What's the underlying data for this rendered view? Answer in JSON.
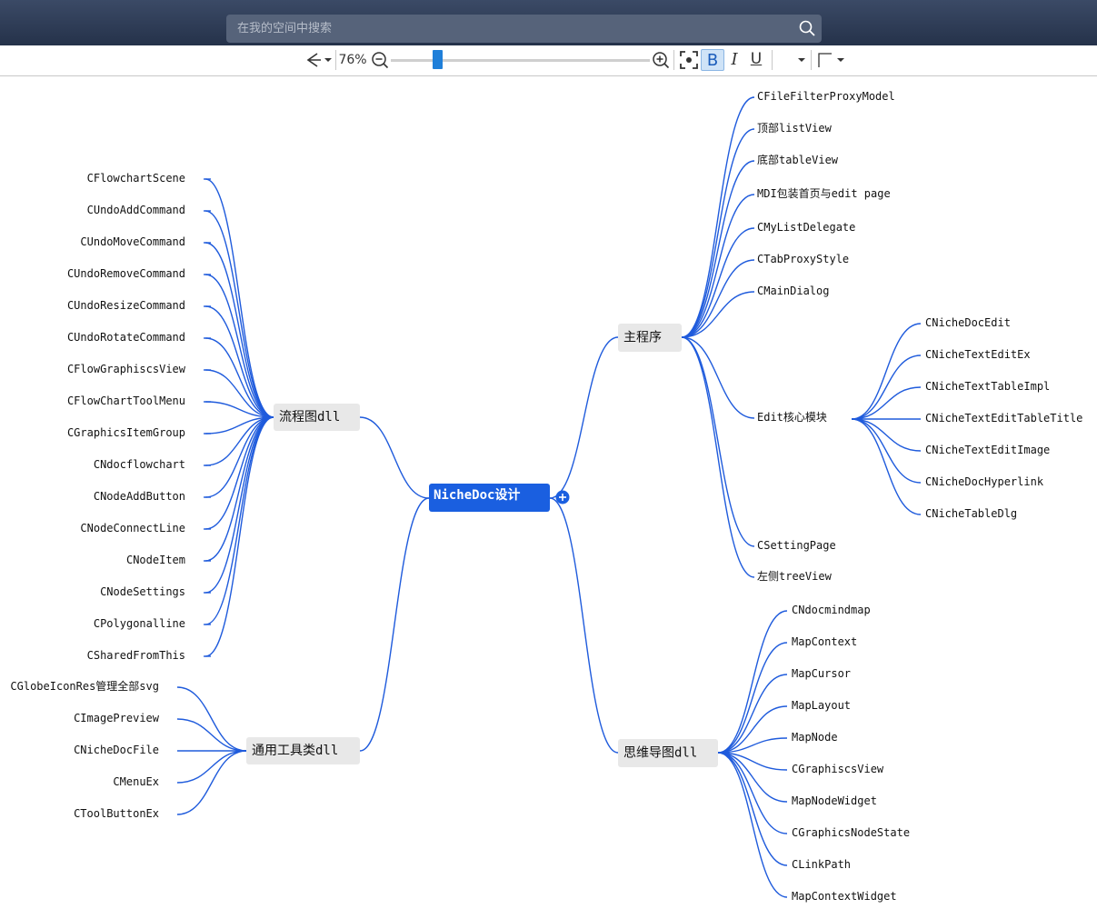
{
  "search": {
    "placeholder": "在我的空间中搜索"
  },
  "toolbar": {
    "zoom": "76%",
    "zoom_level_percent": 76,
    "bold": "B",
    "italic": "I",
    "underline": "U"
  },
  "map": {
    "root": "NicheDoc设计",
    "branches": {
      "flowchart": {
        "label": "流程图dll",
        "children": [
          "CFlowchartScene",
          "CUndoAddCommand",
          "CUndoMoveCommand",
          "CUndoRemoveCommand",
          "CUndoResizeCommand",
          "CUndoRotateCommand",
          "CFlowGraphiscsView",
          "CFlowChartToolMenu",
          "CGraphicsItemGroup",
          "CNdocflowchart",
          "CNodeAddButton",
          "CNodeConnectLine",
          "CNodeItem",
          "CNodeSettings",
          "CPolygonalline",
          "CSharedFromThis"
        ]
      },
      "tools": {
        "label": "通用工具类dll",
        "children": [
          "CGlobeIconRes管理全部svg",
          "CImagePreview",
          "CNicheDocFile",
          "CMenuEx",
          "CToolButtonEx"
        ]
      },
      "main": {
        "label": "主程序",
        "children": [
          "CFileFilterProxyModel",
          "顶部listView",
          "底部tableView",
          "MDI包装首页与edit page",
          "CMyListDelegate",
          "CTabProxyStyle",
          "CMainDialog",
          "Edit核心模块",
          "CSettingPage",
          "左侧treeView"
        ],
        "edit_children": [
          "CNicheDocEdit",
          "CNicheTextEditEx",
          "CNicheTextTableImpl",
          "CNicheTextEditTableTitle",
          "CNicheTextEditImage",
          "CNicheDocHyperlink",
          "CNicheTableDlg"
        ]
      },
      "mindmap": {
        "label": "思维导图dll",
        "children": [
          "CNdocmindmap",
          "MapContext",
          "MapCursor",
          "MapLayout",
          "MapNode",
          "CGraphiscsView",
          "MapNodeWidget",
          "CGraphicsNodeState",
          "CLinkPath",
          "MapContextWidget"
        ]
      }
    }
  }
}
